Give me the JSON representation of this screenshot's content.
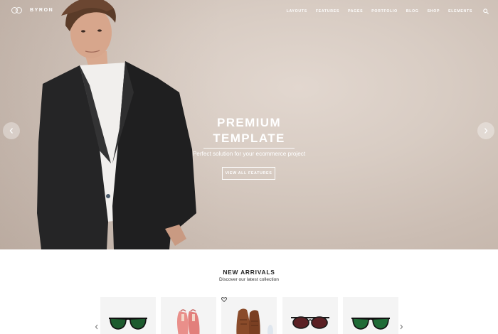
{
  "header": {
    "logo_text": "BYRON",
    "nav": [
      "LAYOUTS",
      "FEATURES",
      "PAGES",
      "PORTFOLIO",
      "BLOG",
      "SHOP",
      "ELEMENTS"
    ]
  },
  "hero": {
    "title_line1": "PREMIUM",
    "title_line2": "TEMPLATE",
    "subtitle": "Perfect solution for your ecommerce project",
    "button_label": "VIEW ALL FEATURES",
    "prev_icon": "chevron-left-icon",
    "next_icon": "chevron-right-icon"
  },
  "new_arrivals": {
    "title": "NEW ARRIVALS",
    "subtitle": "Discover our latest collection",
    "products": [
      {
        "image": "green-sunglasses",
        "wishlist_icon": false
      },
      {
        "image": "pink-heels",
        "wishlist_icon": false
      },
      {
        "image": "brown-brogues",
        "wishlist_icon": true
      },
      {
        "image": "red-sunglasses",
        "wishlist_icon": false
      },
      {
        "image": "green-sunglasses",
        "wishlist_icon": false
      }
    ]
  },
  "colors": {
    "hero_background": "#d8ccc3",
    "text_dark": "#222222",
    "card_background": "#f4f4f4"
  }
}
